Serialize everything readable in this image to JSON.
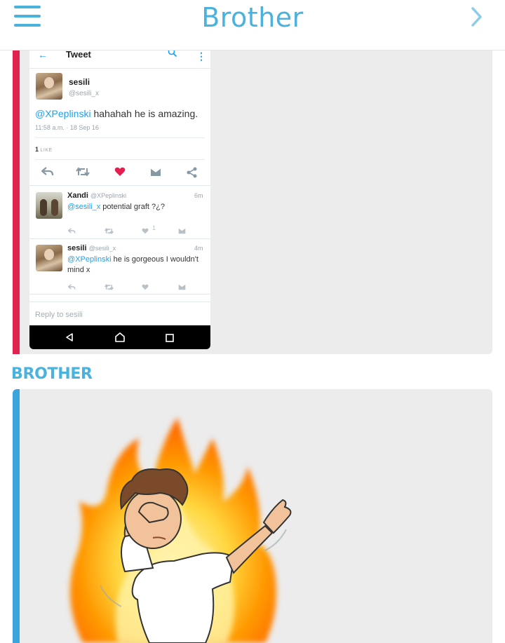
{
  "header": {
    "title": "Brother",
    "menu_icon": "hamburger-menu-icon",
    "next_icon": "chevron-right-icon",
    "accent": "#4ab2dd"
  },
  "messages": [
    {
      "bar_color": "#e0234e",
      "type": "image",
      "screenshot": {
        "top_bar": {
          "title": "Tweet",
          "back_icon": "arrow-left-icon",
          "search_icon": "search-icon",
          "more_icon": "more-vertical-icon"
        },
        "tweet": {
          "name": "sesili",
          "handle": "@sesili_x",
          "mention": "@XPeplinski",
          "text": " hahahah he is amazing.",
          "timestamp": "11:58 a.m. · 18 Sep 16",
          "like_count": "1",
          "like_label": "LIKE"
        },
        "replies": [
          {
            "name": "Xandi",
            "handle": "@XPeplinski",
            "time": "6m",
            "mention": "@sesili_x",
            "text": " potential graft ?¿?",
            "likes": "1"
          },
          {
            "name": "sesili",
            "handle": "@sesili_x",
            "time": "4m",
            "mention": "@XPeplinski",
            "text_line1": " he is gorgeous I wouldn't",
            "text_line2": "mind x"
          }
        ],
        "reply_placeholder": "Reply to sesili",
        "nav_icons": [
          "back-triangle-icon",
          "home-icon",
          "recents-square-icon"
        ]
      }
    },
    {
      "sender": "BROTHER",
      "bar_color": "#3aa4dc",
      "type": "image",
      "image_content": "bitmoji-dab-fire"
    }
  ]
}
